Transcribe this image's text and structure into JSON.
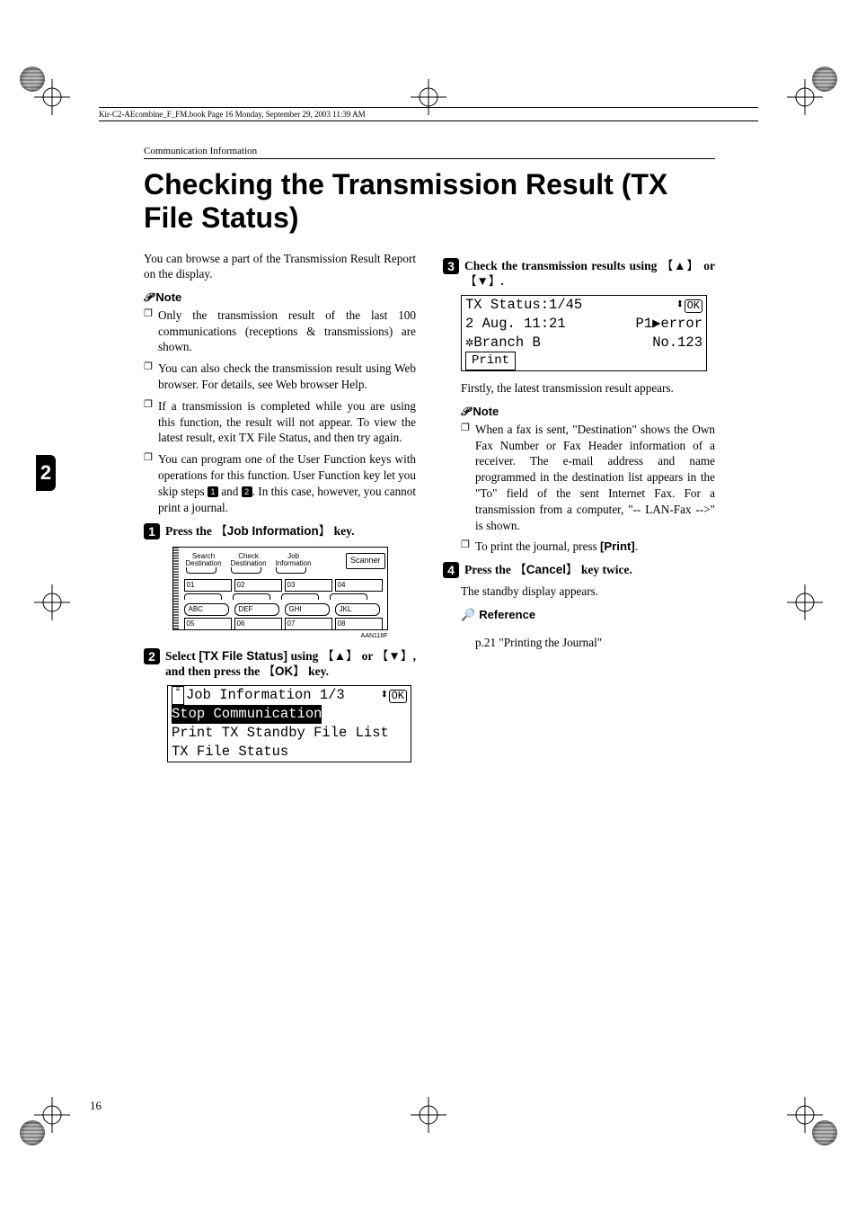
{
  "header_line": "Kir-C2-AEcombine_F_FM.book  Page 16  Monday, September 29, 2003  11:39 AM",
  "running_head": "Communication Information",
  "title": "Checking the Transmission Result (TX File Status)",
  "chapter_tab": "2",
  "page_number": "16",
  "col1": {
    "intro": "You can browse a part of the Transmission Result Report on the display.",
    "note_label": "Note",
    "notes": [
      "Only the transmission result of the last 100 communications (receptions & transmissions) are shown.",
      "You can also check the transmission result using Web browser. For details, see Web browser Help.",
      "If a transmission is completed while you are using this function, the result will not appear. To view the latest result, exit TX File Status, and then try again."
    ],
    "note4_pre": "You can program one of the User Function keys with operations for this function. User Function key let you skip steps ",
    "note4_mid": " and ",
    "note4_post": ". In this case, however, you cannot print a journal.",
    "step1_pre": "Press the ",
    "step1_key": "Job Information",
    "step1_post": " key.",
    "panel": {
      "search": "Search\nDestination",
      "check": "Check\nDestination",
      "job": "Job\nInformation",
      "scanner": "Scanner",
      "row1": [
        "01",
        "02",
        "03",
        "04"
      ],
      "letters": [
        "ABC",
        "DEF",
        "GHI",
        "JKL"
      ],
      "row2": [
        "05",
        "06",
        "07",
        "08"
      ],
      "code": "AAN118F"
    },
    "step2_pre": "Select ",
    "step2_item": "[TX File Status]",
    "step2_mid": " using ",
    "step2_or": " or ",
    "step2_then": ", and then press the ",
    "step2_ok": "OK",
    "step2_post": " key.",
    "lcd1": {
      "line1_left": "Job Information 1/3",
      "line1_right_arrow": "⬍",
      "line1_right_ok": "OK",
      "line2": "Stop Communication",
      "line3": "Print TX Standby File List",
      "line4": "TX File Status"
    }
  },
  "col2": {
    "step3_pre": "Check the transmission results using ",
    "step3_or": " or ",
    "step3_post": ".",
    "lcd2": {
      "line1_left": "TX Status:",
      "line1_mid": "1/45",
      "line1_right_arrow": "⬍",
      "line1_right_ok": "OK",
      "line2_left": "2 Aug. 11:21",
      "line2_right": "P1▶error",
      "line3_left": "✲Branch B",
      "line3_right": "No.123",
      "line4_btn": "Print"
    },
    "after_lcd": "Firstly, the latest transmission result appears.",
    "note_label": "Note",
    "notes": [
      "When a fax is sent, \"Destination\" shows the Own Fax Number or Fax Header information of a receiver. The e-mail address and name programmed in the destination list appears in the \"To\" field of the sent Internet Fax. For a transmission from a computer, \"-- LAN-Fax -->\" is shown."
    ],
    "note2_pre": "To print the journal, press ",
    "note2_key": "[Print]",
    "note2_post": ".",
    "step4_pre": "Press the ",
    "step4_key": "Cancel",
    "step4_post": " key twice.",
    "step4_after": "The standby display appears.",
    "ref_label": "Reference",
    "ref_body": "p.21 \"Printing the Journal\""
  }
}
